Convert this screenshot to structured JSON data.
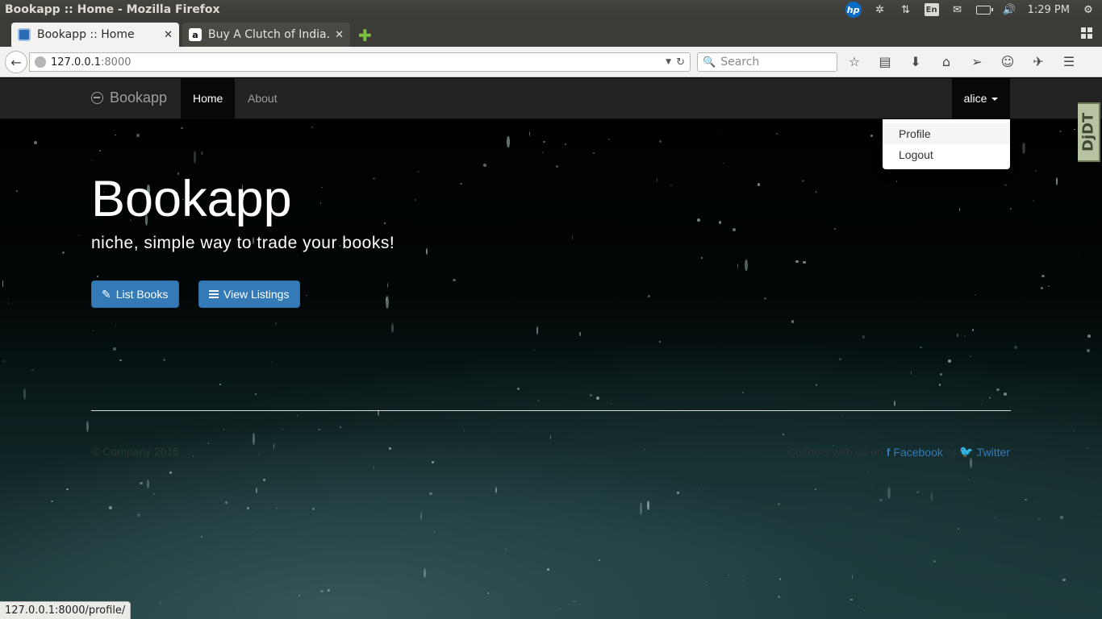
{
  "os": {
    "window_title": "Bookapp :: Home - Mozilla Firefox",
    "keyboard_layout": "En",
    "clock": "1:29 PM",
    "hp_label": "hp"
  },
  "tabs": [
    {
      "label": "Bookapp :: Home",
      "active": true
    },
    {
      "label": "Buy A Clutch of India...",
      "active": false,
      "favicon": "a"
    }
  ],
  "navbar": {
    "url_host": "127.0.0.1",
    "url_port": ":8000",
    "search_placeholder": "Search"
  },
  "site": {
    "brand": "Bookapp",
    "nav": {
      "home": "Home",
      "about": "About",
      "user": "alice"
    },
    "dropdown": [
      "Profile",
      "Logout"
    ],
    "ddt": "DjDT",
    "hero": {
      "title": "Bookapp",
      "subtitle": "niche, simple way to trade your books!",
      "btn_list": "List Books",
      "btn_view": "View Listings"
    },
    "footer": {
      "copyright": "© Company 2015",
      "connect": "Connect with us on",
      "facebook": "Facebook",
      "or": "or",
      "twitter": "Twitter"
    }
  },
  "status_url": "127.0.0.1:8000/profile/",
  "colors": {
    "primary_button": "#337ab7",
    "navbar": "#222222",
    "link": "#337ab7"
  }
}
